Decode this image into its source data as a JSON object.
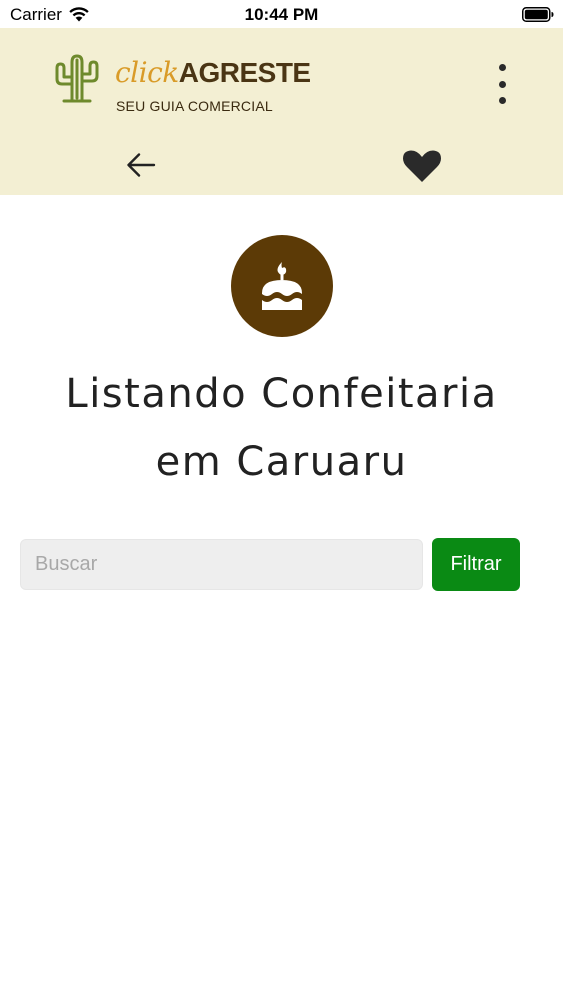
{
  "status_bar": {
    "carrier": "Carrier",
    "time": "10:44 PM",
    "icons": [
      "wifi-icon",
      "battery-icon"
    ]
  },
  "header": {
    "brand_click": "click",
    "brand_agreste": "AGRESTE",
    "tagline": "SEU GUIA COMERCIAL",
    "logo_icon": "cactus-icon",
    "menu_icon": "more-vertical-icon",
    "back_icon": "arrow-left-icon",
    "favorite_icon": "heart-icon",
    "background_color": "#f3efd3"
  },
  "category": {
    "icon": "cake-icon",
    "icon_background": "#5c3a06"
  },
  "title": {
    "line1": "Listando Confeitaria",
    "line2": "em Caruaru"
  },
  "search": {
    "value": "",
    "placeholder": "Buscar"
  },
  "filter": {
    "label": "Filtrar",
    "color": "#0a8a14"
  }
}
